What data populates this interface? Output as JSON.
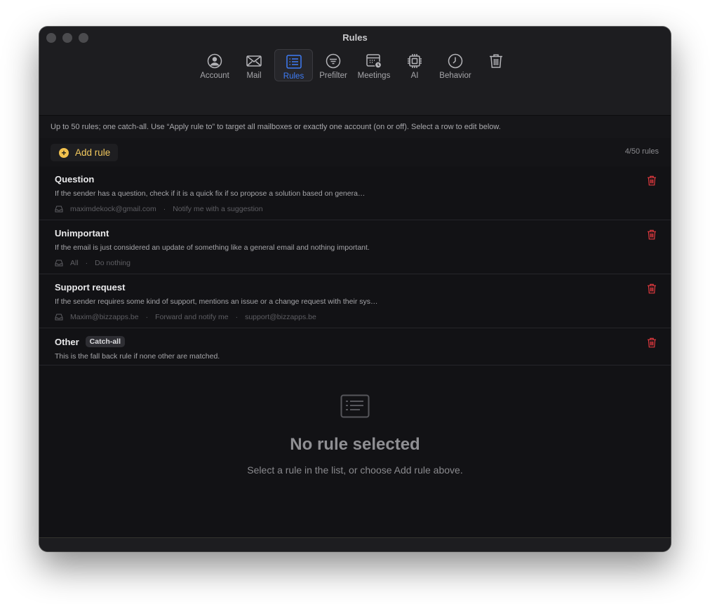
{
  "window": {
    "title": "Rules"
  },
  "toolbar": {
    "account": "Account",
    "mail": "Mail",
    "rules": "Rules",
    "prefilter": "Prefilter",
    "meetings": "Meetings",
    "ai": "AI",
    "behavior": "Behavior",
    "trash_icon": "trash-icon"
  },
  "info": "Up to 50 rules; one catch-all. Use “Apply rule to” to target all mailboxes or exactly one account (on or off). Select a row to edit below.",
  "add_rule": "Add rule",
  "count": "4/50 rules",
  "rules": [
    {
      "name": "Question",
      "description": "If the sender has a question, check if it is a quick fix if so propose a solution based on genera…",
      "mailbox": "maximdekock@gmail.com",
      "action": "Notify me with a suggestion"
    },
    {
      "name": "Unimportant",
      "description": "If the email is just considered an update of something like a general email and nothing important.",
      "mailbox": "All",
      "action": "Do nothing"
    },
    {
      "name": "Support request",
      "description": "If the sender requires some kind of support, mentions an issue or a change request with their sys…",
      "mailbox": "Maxim@bizzapps.be",
      "action": "Forward and notify me",
      "target": "support@bizzapps.be"
    },
    {
      "name": "Other",
      "badge": "Catch-all",
      "description": "This is the fall back rule if none other are matched."
    }
  ],
  "meta_separator": "·",
  "empty": {
    "title": "No rule selected",
    "subtitle": "Select a rule in the list, or choose Add rule above."
  },
  "colors": {
    "accent": "#3e7cf6",
    "add": "#f2c14e",
    "delete": "#e0393e",
    "window_bg": "#121215"
  }
}
